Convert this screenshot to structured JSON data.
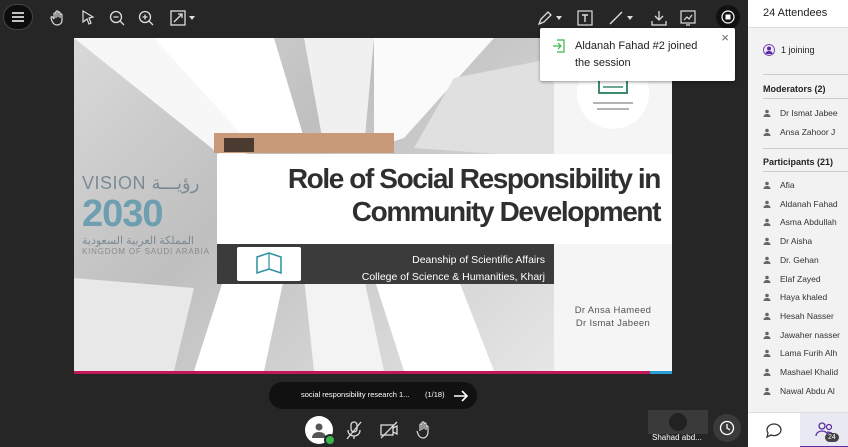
{
  "toolbar": {
    "menu": "menu-icon",
    "tools_left": [
      "hand-icon",
      "pointer-icon",
      "zoom-out-icon",
      "zoom-in-icon",
      "fit-icon"
    ],
    "tools_right": [
      "pen-icon",
      "text-icon",
      "line-icon",
      "download-icon",
      "whiteboard-icon",
      "stop-icon"
    ]
  },
  "slide": {
    "title": "Role of Social Responsibility in Community Development",
    "title_line1": "Role of Social Responsibility in",
    "title_line2": "Community Development",
    "dept_line1": "Deanship of Scientific Affairs",
    "dept_line2": "College of Science & Humanities, Kharj",
    "author1": "Dr Ansa Hameed",
    "author2": "Dr Ismat Jabeen",
    "vision_label": "VISION رؤيـــة",
    "vision_year": "2030",
    "vision_ar": "المملكة العربية السعودية",
    "vision_en": "KINGDOM OF SAUDI ARABIA"
  },
  "notification": {
    "text": "Aldanah Fahad #2 joined the session"
  },
  "share": {
    "file_name": "social responsibility research 1...",
    "page_indicator": "(1/18)"
  },
  "video": {
    "name": "Shahad abd..."
  },
  "sidebar": {
    "header": "24 Attendees",
    "joining": "1 joining",
    "moderators_title": "Moderators (2)",
    "moderators": [
      "Dr Ismat Jabee",
      "Ansa Zahoor J"
    ],
    "participants_title": "Participants (21)",
    "participants": [
      "Afia",
      "Aldanah Fahad",
      "Asma Abdullah",
      "Dr Aisha",
      "Dr. Gehan",
      "Elaf Zayed",
      "Haya khaled",
      "Hesah Nasser",
      "Jawaher nasser",
      "Lama Furih Alh",
      "Mashael Khalid",
      "Nawal Abdu Al"
    ],
    "people_count": "24"
  },
  "colors": {
    "accent": "#5b2ca0",
    "online": "#3bb54a",
    "slide_bar": "#c2185b"
  }
}
